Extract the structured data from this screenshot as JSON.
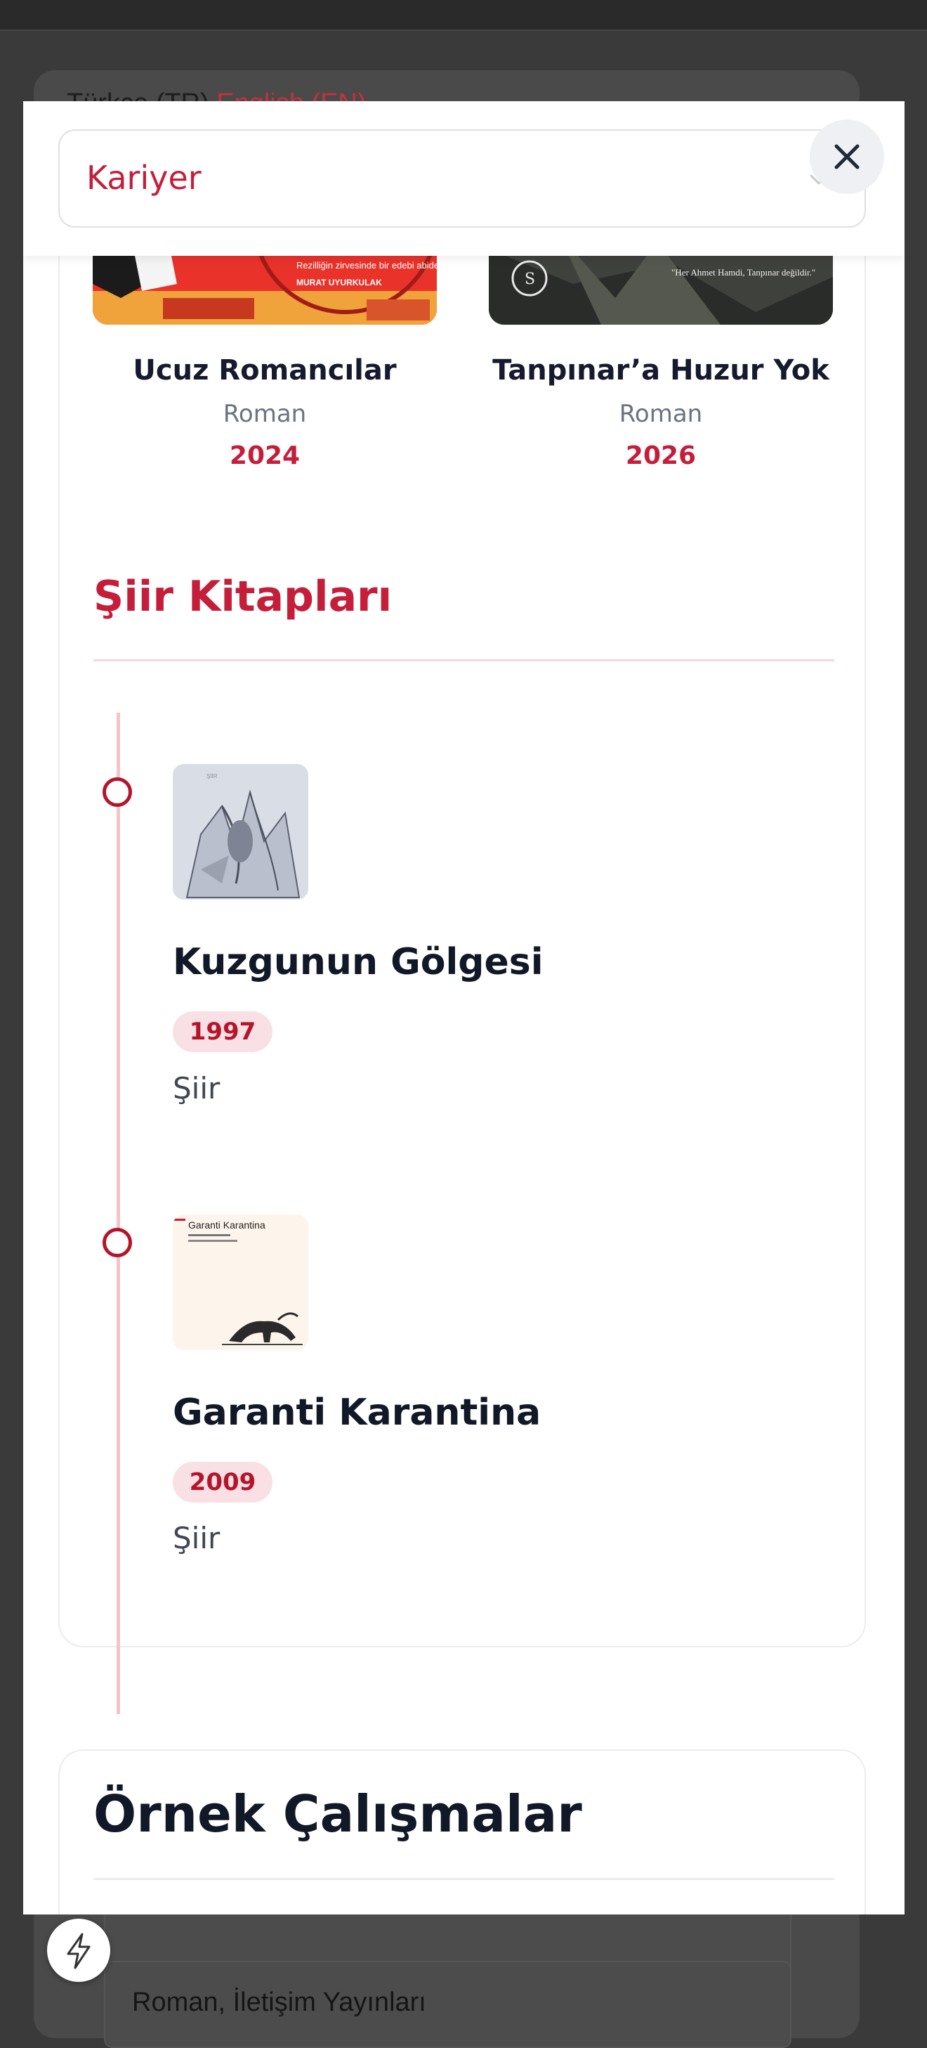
{
  "background": {
    "tabs": [
      "Türkçe (TR)",
      "English (EN)"
    ],
    "list_item": "Roman, İletişim Yayınları"
  },
  "modal": {
    "select": {
      "value": "Kariyer"
    },
    "close_icon": "close-icon"
  },
  "novels": [
    {
      "title": "Ucuz Romancılar",
      "genre": "Roman",
      "year": "2024",
      "cover_tagline": "Rezilliğin zirvesinde bir edebi abidesi",
      "cover_author": "MURAT UYURKULAK"
    },
    {
      "title": "Tanpınar’a Huzur Yok",
      "genre": "Roman",
      "year": "2026",
      "cover_quote": "\"Her Ahmet Hamdi, Tanpınar değildir.\""
    }
  ],
  "poetry": {
    "heading": "Şiir Kitapları",
    "items": [
      {
        "title": "Kuzgunun Gölgesi",
        "year": "1997",
        "genre": "Şiir",
        "cover_label": "ŞİİR"
      },
      {
        "title": "Garanti Karantina",
        "year": "2009",
        "genre": "Şiir",
        "cover_title": "Garanti Karantina"
      }
    ]
  },
  "examples": {
    "heading": "Örnek Çalışmalar"
  },
  "colors": {
    "accent": "#c41e3a",
    "text_dark": "#111827",
    "muted": "#6b7282",
    "badge_bg": "#f8e0e4",
    "overlay": "#3a3a3a"
  },
  "icons": {
    "close": "close-icon",
    "chevron": "chevron-down-icon",
    "fab": "lightning-icon"
  }
}
